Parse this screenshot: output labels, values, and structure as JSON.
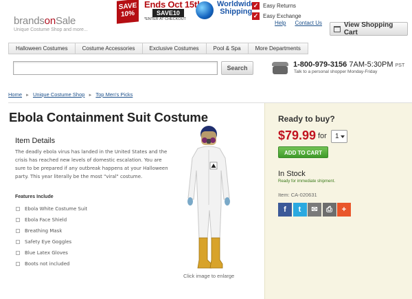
{
  "header": {
    "logo_prefix": "brands",
    "logo_on": "on",
    "logo_suffix": "Sale",
    "tagline": "Unique Costume Shop and more...",
    "promo": {
      "save_line1": "SAVE",
      "save_line2": "10%",
      "ends": "Ends Oct 15th",
      "code": "SAVE10",
      "enter_note": "*ENTER AT CHECKOUT",
      "worldwide_line1": "Worldwide",
      "worldwide_line2": "Shipping"
    },
    "perks": [
      "Easy Returns",
      "Easy Exchange"
    ],
    "links": [
      "Help",
      "Contact Us"
    ],
    "cart_label": "View Shopping Cart"
  },
  "nav": {
    "items": [
      "Halloween Costumes",
      "Costume Accessories",
      "Exclusive Costumes",
      "Pool & Spa",
      "More Departments"
    ]
  },
  "search": {
    "value": "",
    "button_label": "Search"
  },
  "phone": {
    "number": "1-800-979-3156",
    "hours": "7AM-5:30PM",
    "tz": "PST",
    "subtitle": "Talk to a personal shopper Monday-Friday"
  },
  "breadcrumb": [
    "Home",
    "Unique Costume Shop",
    "Top Men's Picks"
  ],
  "product": {
    "title": "Ebola Containment Suit Costume",
    "details_heading": "Item Details",
    "description": "The deadly ebola virus has landed in the United States and the crisis has reached new levels of domestic escalation. You are sure to be prepared if any outbreak happens at your Halloween party. This year literally be the most \"viral\" costume.",
    "features_heading": "Features Include",
    "features": [
      "Ebola White Costume Suit",
      "Ebola Face Shield",
      "Breathing Mask",
      "Safety Eye Goggles",
      "Blue Latex Gloves",
      "Boots not included"
    ],
    "image_caption": "Click image to enlarge"
  },
  "buy": {
    "heading": "Ready to buy?",
    "price": "$79.99",
    "for_label": "for",
    "quantity": "1",
    "add_label": "ADD TO CART",
    "stock": "In Stock",
    "ship_note": "Ready for immediate shipment.",
    "item_number": "Item: CA-020631"
  },
  "share": [
    {
      "icon": "facebook-icon",
      "glyph": "f",
      "color": "#3b5998"
    },
    {
      "icon": "twitter-icon",
      "glyph": "t",
      "color": "#2aa9e0"
    },
    {
      "icon": "email-icon",
      "glyph": "✉",
      "color": "#7a7a7a"
    },
    {
      "icon": "print-icon",
      "glyph": "⎙",
      "color": "#6d6d6d"
    },
    {
      "icon": "more-share-icon",
      "glyph": "+",
      "color": "#e9562a"
    }
  ]
}
